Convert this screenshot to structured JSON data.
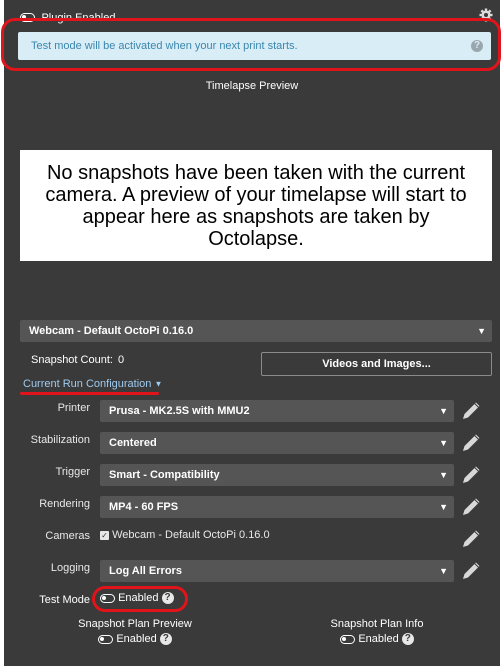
{
  "header": {
    "plugin_enabled_label": "Plugin Enabled",
    "settings_icon": "gear-icon"
  },
  "alert": {
    "text": "Test mode will be activated when your next print starts.",
    "help_glyph": "?"
  },
  "preview": {
    "title": "Timelapse Preview",
    "message": "No snapshots have been taken with the current camera. A preview of your timelapse will start to appear here as snapshots are taken by Octolapse."
  },
  "camera_select": {
    "value": "Webcam - Default OctoPi 0.16.0"
  },
  "snapshot_count": {
    "label": "Snapshot Count:",
    "value": "0"
  },
  "videos_button": {
    "label": "Videos and Images..."
  },
  "config": {
    "title": "Current Run Configuration",
    "rows": [
      {
        "label": "Printer",
        "value": "Prusa - MK2.5S with MMU2"
      },
      {
        "label": "Stabilization",
        "value": "Centered"
      },
      {
        "label": "Trigger",
        "value": "Smart - Compatibility"
      },
      {
        "label": "Rendering",
        "value": "MP4 - 60 FPS"
      },
      {
        "label": "Cameras",
        "value": "Webcam - Default OctoPi 0.16.0"
      },
      {
        "label": "Logging",
        "value": "Log All Errors"
      }
    ]
  },
  "test_mode": {
    "label": "Test Mode",
    "value": "Enabled"
  },
  "plan_preview": {
    "label": "Snapshot Plan Preview",
    "value": "Enabled"
  },
  "plan_info": {
    "label": "Snapshot Plan Info",
    "value": "Enabled"
  },
  "colors": {
    "panel": "#3a3a3a",
    "alert_bg": "#d9edf7",
    "alert_text": "#3a87ad",
    "highlight": "#e0141a",
    "select_bg": "#555555"
  }
}
